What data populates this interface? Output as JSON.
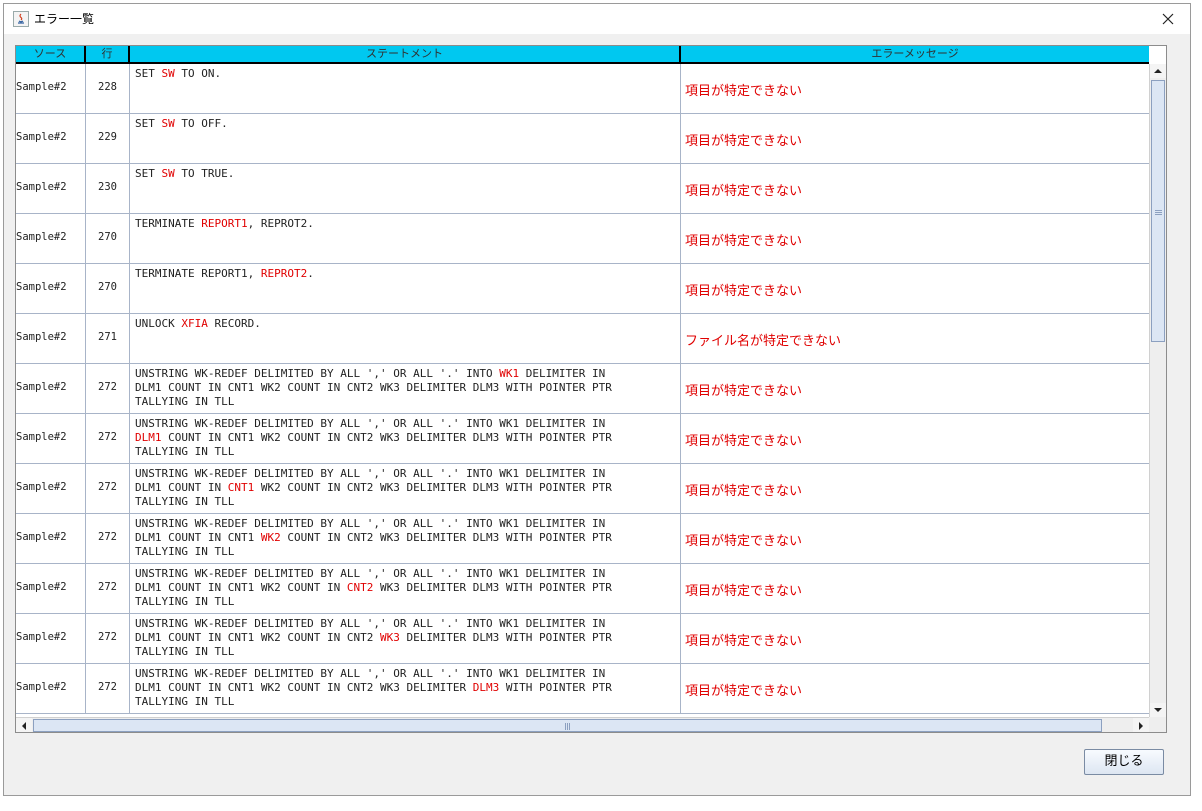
{
  "window": {
    "title": "エラー一覧",
    "close_button_label": "閉じる"
  },
  "table": {
    "columns": [
      "ソース",
      "行",
      "ステートメント",
      "エラーメッセージ"
    ],
    "rows": [
      {
        "source": "Sample#2",
        "line": "228",
        "statement": [
          {
            "t": "SET "
          },
          {
            "t": "SW",
            "hl": true
          },
          {
            "t": " TO ON."
          }
        ],
        "error": "項目が特定できない"
      },
      {
        "source": "Sample#2",
        "line": "229",
        "statement": [
          {
            "t": "SET "
          },
          {
            "t": "SW",
            "hl": true
          },
          {
            "t": " TO OFF."
          }
        ],
        "error": "項目が特定できない"
      },
      {
        "source": "Sample#2",
        "line": "230",
        "statement": [
          {
            "t": "SET "
          },
          {
            "t": "SW",
            "hl": true
          },
          {
            "t": " TO TRUE."
          }
        ],
        "error": "項目が特定できない"
      },
      {
        "source": "Sample#2",
        "line": "270",
        "statement": [
          {
            "t": "TERMINATE "
          },
          {
            "t": "REPORT1",
            "hl": true
          },
          {
            "t": ", REPROT2."
          }
        ],
        "error": "項目が特定できない"
      },
      {
        "source": "Sample#2",
        "line": "270",
        "statement": [
          {
            "t": "TERMINATE REPORT1, "
          },
          {
            "t": "REPROT2",
            "hl": true
          },
          {
            "t": "."
          }
        ],
        "error": "項目が特定できない"
      },
      {
        "source": "Sample#2",
        "line": "271",
        "statement": [
          {
            "t": "UNLOCK "
          },
          {
            "t": "XFIA",
            "hl": true
          },
          {
            "t": " RECORD."
          }
        ],
        "error": "ファイル名が特定できない"
      },
      {
        "source": "Sample#2",
        "line": "272",
        "statement": [
          {
            "t": "UNSTRING WK-REDEF DELIMITED BY ALL ',' OR ALL '.' INTO "
          },
          {
            "t": "WK1",
            "hl": true
          },
          {
            "t": " DELIMITER IN\nDLM1 COUNT IN CNT1 WK2 COUNT IN CNT2 WK3 DELIMITER DLM3 WITH POINTER PTR\nTALLYING IN TLL"
          }
        ],
        "error": "項目が特定できない"
      },
      {
        "source": "Sample#2",
        "line": "272",
        "statement": [
          {
            "t": "UNSTRING WK-REDEF DELIMITED BY ALL ',' OR ALL '.' INTO WK1 DELIMITER IN\n"
          },
          {
            "t": "DLM1",
            "hl": true
          },
          {
            "t": " COUNT IN CNT1 WK2 COUNT IN CNT2 WK3 DELIMITER DLM3 WITH POINTER PTR\nTALLYING IN TLL"
          }
        ],
        "error": "項目が特定できない"
      },
      {
        "source": "Sample#2",
        "line": "272",
        "statement": [
          {
            "t": "UNSTRING WK-REDEF DELIMITED BY ALL ',' OR ALL '.' INTO WK1 DELIMITER IN\nDLM1 COUNT IN "
          },
          {
            "t": "CNT1",
            "hl": true
          },
          {
            "t": " WK2 COUNT IN CNT2 WK3 DELIMITER DLM3 WITH POINTER PTR\nTALLYING IN TLL"
          }
        ],
        "error": "項目が特定できない"
      },
      {
        "source": "Sample#2",
        "line": "272",
        "statement": [
          {
            "t": "UNSTRING WK-REDEF DELIMITED BY ALL ',' OR ALL '.' INTO WK1 DELIMITER IN\nDLM1 COUNT IN CNT1 "
          },
          {
            "t": "WK2",
            "hl": true
          },
          {
            "t": " COUNT IN CNT2 WK3 DELIMITER DLM3 WITH POINTER PTR\nTALLYING IN TLL"
          }
        ],
        "error": "項目が特定できない"
      },
      {
        "source": "Sample#2",
        "line": "272",
        "statement": [
          {
            "t": "UNSTRING WK-REDEF DELIMITED BY ALL ',' OR ALL '.' INTO WK1 DELIMITER IN\nDLM1 COUNT IN CNT1 WK2 COUNT IN "
          },
          {
            "t": "CNT2",
            "hl": true
          },
          {
            "t": " WK3 DELIMITER DLM3 WITH POINTER PTR\nTALLYING IN TLL"
          }
        ],
        "error": "項目が特定できない"
      },
      {
        "source": "Sample#2",
        "line": "272",
        "statement": [
          {
            "t": "UNSTRING WK-REDEF DELIMITED BY ALL ',' OR ALL '.' INTO WK1 DELIMITER IN\nDLM1 COUNT IN CNT1 WK2 COUNT IN CNT2 "
          },
          {
            "t": "WK3",
            "hl": true
          },
          {
            "t": " DELIMITER DLM3 WITH POINTER PTR\nTALLYING IN TLL"
          }
        ],
        "error": "項目が特定できない"
      },
      {
        "source": "Sample#2",
        "line": "272",
        "statement": [
          {
            "t": "UNSTRING WK-REDEF DELIMITED BY ALL ',' OR ALL '.' INTO WK1 DELIMITER IN\nDLM1 COUNT IN CNT1 WK2 COUNT IN CNT2 WK3 DELIMITER "
          },
          {
            "t": "DLM3",
            "hl": true
          },
          {
            "t": " WITH POINTER PTR\nTALLYING IN TLL"
          }
        ],
        "error": "項目が特定できない"
      }
    ]
  },
  "colors": {
    "header_bg": "#00c8f0",
    "highlight": "#e00000",
    "grid_line": "#a8b4c8"
  }
}
